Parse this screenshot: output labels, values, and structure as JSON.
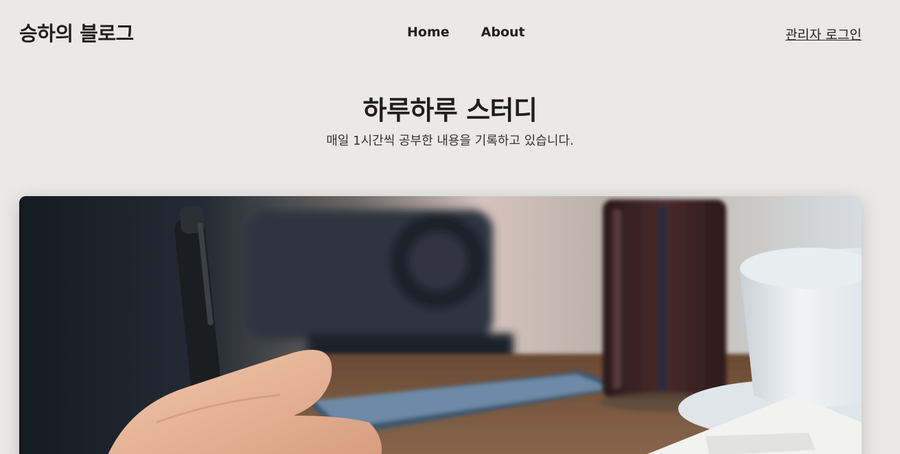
{
  "header": {
    "brand": "승하의 블로그",
    "nav": [
      {
        "label": "Home"
      },
      {
        "label": "About"
      }
    ],
    "admin_login": "관리자 로그인"
  },
  "hero": {
    "title": "하루하루 스터디",
    "subtitle": "매일 1시간씩 공부한 내용을 기록하고 있습니다."
  },
  "cover_image": {
    "description_icon": "photo-icon"
  }
}
